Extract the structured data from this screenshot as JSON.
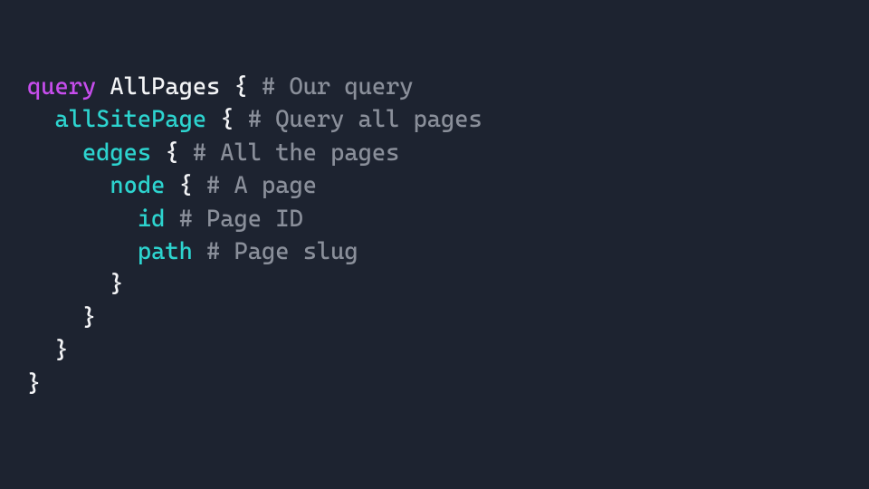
{
  "code": {
    "lines": [
      {
        "indent": 0,
        "tokens": [
          {
            "cls": "kw",
            "t": "query"
          },
          {
            "cls": null,
            "t": " "
          },
          {
            "cls": "name",
            "t": "AllPages"
          },
          {
            "cls": null,
            "t": " "
          },
          {
            "cls": "brace",
            "t": "{"
          },
          {
            "cls": null,
            "t": " "
          },
          {
            "cls": "comment",
            "t": "# Our query"
          }
        ]
      },
      {
        "indent": 1,
        "tokens": [
          {
            "cls": "field",
            "t": "allSitePage"
          },
          {
            "cls": null,
            "t": " "
          },
          {
            "cls": "brace",
            "t": "{"
          },
          {
            "cls": null,
            "t": " "
          },
          {
            "cls": "comment",
            "t": "# Query all pages"
          }
        ]
      },
      {
        "indent": 2,
        "tokens": [
          {
            "cls": "field",
            "t": "edges"
          },
          {
            "cls": null,
            "t": " "
          },
          {
            "cls": "brace",
            "t": "{"
          },
          {
            "cls": null,
            "t": " "
          },
          {
            "cls": "comment",
            "t": "# All the pages"
          }
        ]
      },
      {
        "indent": 3,
        "tokens": [
          {
            "cls": "field",
            "t": "node"
          },
          {
            "cls": null,
            "t": " "
          },
          {
            "cls": "brace",
            "t": "{"
          },
          {
            "cls": null,
            "t": " "
          },
          {
            "cls": "comment",
            "t": "# A page"
          }
        ]
      },
      {
        "indent": 4,
        "tokens": [
          {
            "cls": "field",
            "t": "id"
          },
          {
            "cls": null,
            "t": " "
          },
          {
            "cls": "comment",
            "t": "# Page ID"
          }
        ]
      },
      {
        "indent": 4,
        "tokens": [
          {
            "cls": "field",
            "t": "path"
          },
          {
            "cls": null,
            "t": " "
          },
          {
            "cls": "comment",
            "t": "# Page slug"
          }
        ]
      },
      {
        "indent": 3,
        "tokens": [
          {
            "cls": "brace",
            "t": "}"
          }
        ]
      },
      {
        "indent": 2,
        "tokens": [
          {
            "cls": "brace",
            "t": "}"
          }
        ]
      },
      {
        "indent": 1,
        "tokens": [
          {
            "cls": "brace",
            "t": "}"
          }
        ]
      },
      {
        "indent": 0,
        "tokens": [
          {
            "cls": "brace",
            "t": "}"
          }
        ]
      }
    ]
  }
}
